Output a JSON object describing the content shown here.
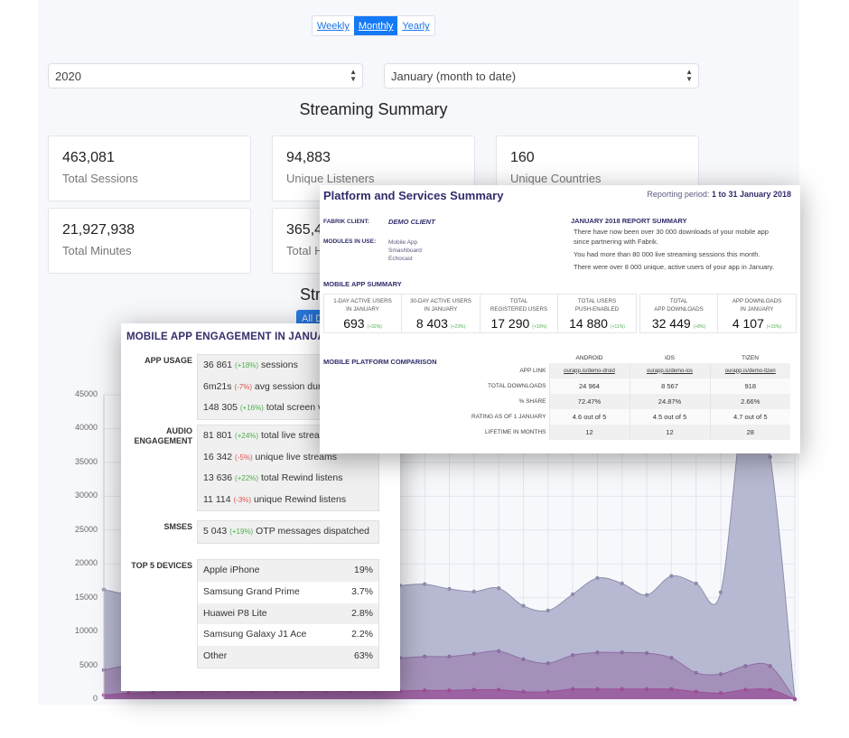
{
  "dashboard": {
    "period_toggle": [
      {
        "label": "Weekly",
        "active": false
      },
      {
        "label": "Monthly",
        "active": true
      },
      {
        "label": "Yearly",
        "active": false
      }
    ],
    "year_select": "2020",
    "month_select": "January (month to date)",
    "title": "Streaming Summary",
    "stats": [
      {
        "value": "463,081",
        "label": "Total Sessions"
      },
      {
        "value": "94,883",
        "label": "Unique Listeners"
      },
      {
        "value": "160",
        "label": "Unique Countries"
      },
      {
        "value": "21,927,938",
        "label": "Total Minutes"
      },
      {
        "value": "365,4",
        "label": "Total H"
      }
    ],
    "second_heading": "Str",
    "all_button": "All D"
  },
  "chart_data": {
    "type": "area",
    "ylim": [
      0,
      45000
    ],
    "yticks": [
      "0",
      "5000",
      "10000",
      "15000",
      "20000",
      "25000",
      "30000",
      "35000",
      "40000",
      "45000"
    ],
    "grid": true,
    "colors": {
      "top": "#b3b4cf",
      "middle": "#a189b6",
      "bottom": "#9b5a9e"
    },
    "series": [
      {
        "values": [
          16200,
          15500,
          15800,
          16000,
          16500,
          16200,
          15800,
          16400,
          16000,
          15600,
          16200,
          16600,
          16800,
          17000,
          16300,
          15900,
          16400,
          13800,
          13100,
          15500,
          17900,
          17100,
          15400,
          18200,
          17100,
          15800,
          44500,
          35800,
          0
        ]
      },
      {
        "values": [
          4300,
          5000,
          5400,
          5600,
          5800,
          6000,
          5900,
          6100,
          6000,
          5900,
          6000,
          6100,
          6100,
          6300,
          6300,
          6700,
          7100,
          5900,
          5300,
          6500,
          6900,
          6900,
          6800,
          6100,
          3900,
          3700,
          4900,
          4900,
          0
        ]
      },
      {
        "values": [
          600,
          900,
          1000,
          1100,
          1100,
          1200,
          1100,
          1200,
          1200,
          1100,
          1200,
          1200,
          1200,
          1300,
          1300,
          1400,
          1400,
          1100,
          1100,
          1500,
          1500,
          1500,
          1500,
          1500,
          1100,
          900,
          1400,
          1400,
          0
        ]
      }
    ]
  },
  "engagement": {
    "title": "MOBILE APP ENGAGEMENT IN JANUARY",
    "app_usage": {
      "label": "APP USAGE",
      "lines": [
        {
          "value": "36 861",
          "change": "(+18%)",
          "dir": "up",
          "text": "sessions"
        },
        {
          "value": "6m21s",
          "change": "(-7%)",
          "dir": "dn",
          "text": "avg session dur"
        },
        {
          "value": "148 305",
          "change": "(+16%)",
          "dir": "up",
          "text": "total screen v"
        }
      ]
    },
    "audio": {
      "label": "AUDIO ENGAGEMENT",
      "lines": [
        {
          "value": "81 801",
          "change": "(+24%)",
          "dir": "up",
          "text": "total live strea"
        },
        {
          "value": "16 342",
          "change": "(-5%)",
          "dir": "dn",
          "text": "unique live streams"
        },
        {
          "value": "13 636",
          "change": "(+22%)",
          "dir": "up",
          "text": "total Rewind listens"
        },
        {
          "value": "11 114",
          "change": "(-3%)",
          "dir": "dn",
          "text": "unique Rewind listens"
        }
      ]
    },
    "smses": {
      "label": "SMSES",
      "lines": [
        {
          "value": "5 043",
          "change": "(+19%)",
          "dir": "up",
          "text": "OTP messages dispatched"
        }
      ]
    },
    "devices": {
      "label": "TOP 5 DEVICES",
      "items": [
        {
          "name": "Apple iPhone",
          "pct": "19%"
        },
        {
          "name": "Samsung Grand Prime",
          "pct": "3.7%"
        },
        {
          "name": "Huawei P8 Lite",
          "pct": "2.8%"
        },
        {
          "name": "Samsung Galaxy J1 Ace",
          "pct": "2.2%"
        },
        {
          "name": "Other",
          "pct": "63%"
        }
      ]
    }
  },
  "platform": {
    "title": "Platform and Services Summary",
    "period_label": "Reporting period:",
    "period": "1 to 31 January 2018",
    "client_label": "FABRIK CLIENT:",
    "client": "DEMO CLIENT",
    "modules_label": "MODULES IN USE:",
    "modules": [
      "Mobile App",
      "Smashboard",
      "Echocast"
    ],
    "report_title": "JANUARY 2018 REPORT SUMMARY",
    "report_lines": [
      "There have now been over 30 000 downloads of your mobile app",
      "since partnering with Fabrik.",
      "You had more than 80 000 live streaming sessions this month.",
      "There were over 8 000 unique, active users of your app in January."
    ],
    "app_summary_title": "MOBILE APP SUMMARY",
    "kpi_groups": [
      [
        {
          "l1": "1-DAY ACTIVE USERS",
          "l2": "IN JANUARY",
          "v": "693",
          "c": "(+32%)"
        },
        {
          "l1": "30-DAY ACTIVE USERS",
          "l2": "IN JANUARY",
          "v": "8 403",
          "c": "(+23%)"
        }
      ],
      [
        {
          "l1": "TOTAL",
          "l2": "REGISTERED USERS",
          "v": "17 290",
          "c": "(+10%)"
        },
        {
          "l1": "TOTAL USERS",
          "l2": "PUSH-ENABLED",
          "v": "14 880",
          "c": "(+11%)"
        }
      ],
      [
        {
          "l1": "TOTAL",
          "l2": "APP DOWNLOADS",
          "v": "32 449",
          "c": "(+8%)"
        },
        {
          "l1": "APP DOWNLOADS",
          "l2": "IN JANUARY",
          "v": "4 107",
          "c": "(+15%)"
        }
      ]
    ],
    "comparison_title": "MOBILE PLATFORM COMPARISON",
    "platforms": [
      "ANDROID",
      "iOS",
      "TIZEN"
    ],
    "rows": [
      {
        "label": "APP LINK",
        "values": [
          "ourapp.is/demo-droid",
          "ourapp.is/demo-ios",
          "ourapp.is/demo-tizen"
        ]
      },
      {
        "label": "TOTAL DOWNLOADS",
        "values": [
          "24 964",
          "8 567",
          "918"
        ]
      },
      {
        "label": "% SHARE",
        "values": [
          "72.47%",
          "24.87%",
          "2.66%"
        ]
      },
      {
        "label": "RATING AS OF 1 JANUARY",
        "values": [
          "4.6 out of 5",
          "4.5 out of 5",
          "4.7 out of 5"
        ]
      },
      {
        "label": "LIFETIME IN MONTHS",
        "values": [
          "12",
          "12",
          "28"
        ]
      }
    ]
  }
}
